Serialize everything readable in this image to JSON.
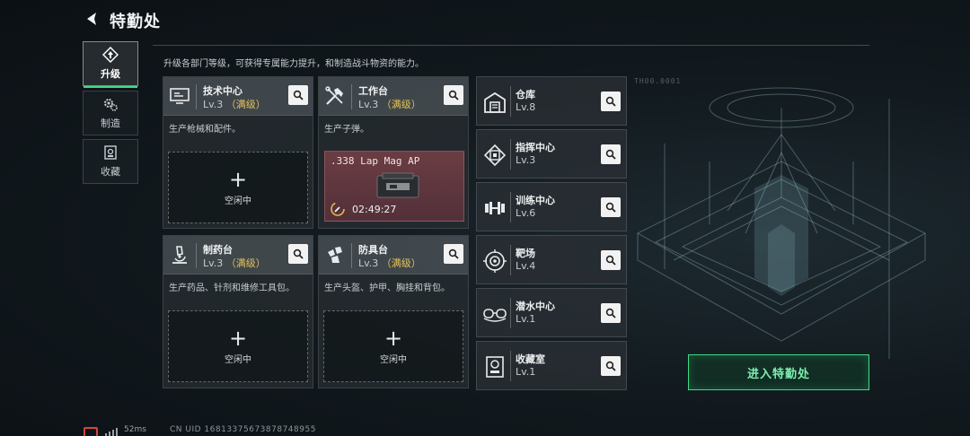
{
  "header": {
    "title": "特勤处"
  },
  "nav": [
    {
      "id": "upgrade",
      "label": "升级",
      "active": true,
      "icon": "upgrade-icon"
    },
    {
      "id": "craft",
      "label": "制造",
      "active": false,
      "icon": "gears-icon"
    },
    {
      "id": "collection",
      "label": "收藏",
      "active": false,
      "icon": "collection-icon"
    }
  ],
  "description": "升级各部门等级，可获得专属能力提升，和制造战斗物资的能力。",
  "cards": [
    {
      "name": "技术中心",
      "level": "Lv.3",
      "maxed": "（满级）",
      "desc": "生产枪械和配件。",
      "slot": {
        "status": "空闲中"
      },
      "icon": "monitor-icon"
    },
    {
      "name": "工作台",
      "level": "Lv.3",
      "maxed": "（满级）",
      "desc": "生产子弹。",
      "craft": {
        "item": ".338 Lap Mag AP",
        "timer": "02:49:27"
      },
      "icon": "tools-icon"
    },
    {
      "name": "制药台",
      "level": "Lv.3",
      "maxed": "（满级）",
      "desc": "生产药品、针剂和维修工具包。",
      "slot": {
        "status": "空闲中"
      },
      "icon": "microscope-icon"
    },
    {
      "name": "防具台",
      "level": "Lv.3",
      "maxed": "（满级）",
      "desc": "生产头盔、护甲、胸挂和背包。",
      "slot": {
        "status": "空闲中"
      },
      "icon": "armor-icon"
    }
  ],
  "facilities": [
    {
      "name": "仓库",
      "level": "Lv.8",
      "icon": "warehouse-icon"
    },
    {
      "name": "指挥中心",
      "level": "Lv.3",
      "icon": "command-chip-icon"
    },
    {
      "name": "训练中心",
      "level": "Lv.6",
      "icon": "dumbbell-icon"
    },
    {
      "name": "靶场",
      "level": "Lv.4",
      "icon": "target-icon"
    },
    {
      "name": "潜水中心",
      "level": "Lv.1",
      "icon": "diving-goggles-icon"
    },
    {
      "name": "收藏室",
      "level": "Lv.1",
      "icon": "trophy-room-icon"
    }
  ],
  "enter_button": "进入特勤处",
  "footer": {
    "ping": "52ms",
    "uid": "CN UID 16813375673878748955"
  },
  "scene_label": "TH00.0001",
  "colors": {
    "accent_green": "#3ddc84",
    "maxed_gold": "#e3c15a",
    "craft_bg": "#6b3d42",
    "net_warning": "#d8453a"
  }
}
